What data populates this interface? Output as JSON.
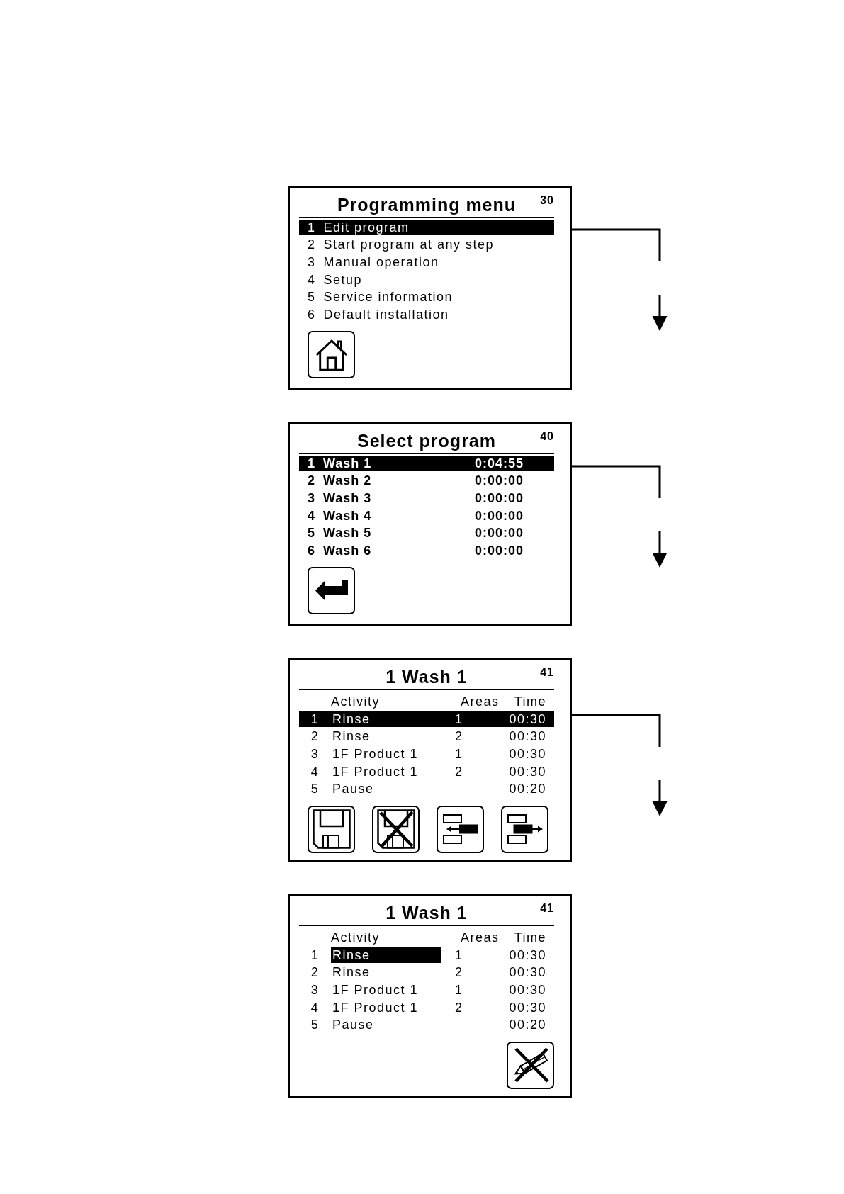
{
  "screens": [
    {
      "kind": "menu",
      "title": "Programming menu",
      "number": "30",
      "items": [
        {
          "number": "1",
          "label": "Edit program",
          "selected": true
        },
        {
          "number": "2",
          "label": "Start program at any step",
          "selected": false
        },
        {
          "number": "3",
          "label": "Manual operation",
          "selected": false
        },
        {
          "number": "4",
          "label": "Setup",
          "selected": false
        },
        {
          "number": "5",
          "label": "Service information",
          "selected": false
        },
        {
          "number": "6",
          "label": "Default installation",
          "selected": false
        }
      ]
    },
    {
      "kind": "program_list",
      "title": "Select program",
      "number": "40",
      "items": [
        {
          "number": "1",
          "label": "Wash 1",
          "time": "0:04:55",
          "selected": true
        },
        {
          "number": "2",
          "label": "Wash 2",
          "time": "0:00:00",
          "selected": false
        },
        {
          "number": "3",
          "label": "Wash 3",
          "time": "0:00:00",
          "selected": false
        },
        {
          "number": "4",
          "label": "Wash 4",
          "time": "0:00:00",
          "selected": false
        },
        {
          "number": "5",
          "label": "Wash 5",
          "time": "0:00:00",
          "selected": false
        },
        {
          "number": "6",
          "label": "Wash 6",
          "time": "0:00:00",
          "selected": false
        }
      ]
    },
    {
      "kind": "step_list",
      "title": "1 Wash 1",
      "number": "41",
      "columns": [
        "Activity",
        "Areas",
        "Time"
      ],
      "steps": [
        {
          "number": "1",
          "activity": "Rinse",
          "areas": "1",
          "time": "00:30",
          "selected": true
        },
        {
          "number": "2",
          "activity": "Rinse",
          "areas": "2",
          "time": "00:30",
          "selected": false
        },
        {
          "number": "3",
          "activity": "1F Product 1",
          "areas": "1",
          "time": "00:30",
          "selected": false
        },
        {
          "number": "4",
          "activity": "1F Product 1",
          "areas": "2",
          "time": "00:30",
          "selected": false
        },
        {
          "number": "5",
          "activity": "Pause",
          "time": "00:20",
          "selected": false
        }
      ]
    },
    {
      "kind": "step_edit",
      "title": "1 Wash 1",
      "number": "41",
      "columns": [
        "Activity",
        "Areas",
        "Time"
      ],
      "steps": [
        {
          "number": "1",
          "activity": "Rinse",
          "areas": "1",
          "time": "00:30",
          "selected": true
        },
        {
          "number": "2",
          "activity": "Rinse",
          "areas": "2",
          "time": "00:30",
          "selected": false
        },
        {
          "number": "3",
          "activity": "1F Product 1",
          "areas": "1",
          "time": "00:30",
          "selected": false
        },
        {
          "number": "4",
          "activity": "1F Product 1",
          "areas": "2",
          "time": "00:30",
          "selected": false
        },
        {
          "number": "5",
          "activity": "Pause",
          "time": "00:20",
          "selected": false
        }
      ]
    }
  ]
}
